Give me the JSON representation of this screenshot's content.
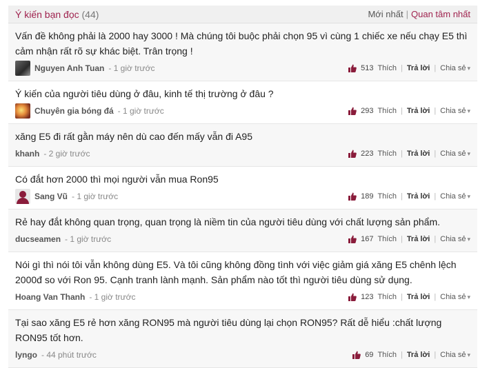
{
  "header": {
    "title": "Ý kiến bạn đọc",
    "count": "(44)",
    "sort_newest": "Mới nhất",
    "separator": "|",
    "sort_popular": "Quan tâm nhất"
  },
  "comments": [
    {
      "text": "Vấn đề không phải là 2000 hay 3000 ! Mà chúng tôi buộc phải chọn 95 vì cùng 1 chiếc xe nếu chạy E5 thì cảm nhận rất rõ sự khác biệt. Trân trọng !",
      "author": "Nguyen Anh Tuan",
      "time": "- 1 giờ trước",
      "likes": "513",
      "like_label": "Thích",
      "reply_label": "Trả lời",
      "share_label": "Chia sẻ"
    },
    {
      "text": "Ý kiến của người tiêu dùng ở đâu, kinh tế thị trường ở đâu ?",
      "author": "Chuyên gia bóng đá",
      "time": "- 1 giờ trước",
      "likes": "293",
      "like_label": "Thích",
      "reply_label": "Trả lời",
      "share_label": "Chia sẻ"
    },
    {
      "text": "xăng E5 đi rất gằn máy nên dù cao đến mấy vẫn đi A95",
      "author": "khanh",
      "time": "- 2 giờ trước",
      "likes": "223",
      "like_label": "Thích",
      "reply_label": "Trả lời",
      "share_label": "Chia sẻ"
    },
    {
      "text": "Có đắt hơn 2000 thì mọi người vẫn mua Ron95",
      "author": "Sang Vũ",
      "time": "- 1 giờ trước",
      "likes": "189",
      "like_label": "Thích",
      "reply_label": "Trả lời",
      "share_label": "Chia sẻ"
    },
    {
      "text": "Rẻ hay đắt không quan trọng, quan trọng là niềm tin của người tiêu dùng với chất lượng sản phẩm.",
      "author": "ducseamen",
      "time": "- 1 giờ trước",
      "likes": "167",
      "like_label": "Thích",
      "reply_label": "Trả lời",
      "share_label": "Chia sẻ"
    },
    {
      "text": "Nói gì thì nói tôi vẫn không dùng E5. Và tôi cũng không đồng tình với việc giảm giá xăng E5 chênh lệch 2000đ so với Ron 95. Cạnh tranh lành mạnh. Sản phẩm nào tốt thì người tiêu dùng sử dụng.",
      "author": "Hoang Van Thanh",
      "time": "- 1 giờ trước",
      "likes": "123",
      "like_label": "Thích",
      "reply_label": "Trả lời",
      "share_label": "Chia sẻ"
    },
    {
      "text": "Tại sao xăng E5 rẻ hơn xăng RON95 mà người tiêu dùng lại chọn RON95? Rất dễ hiểu :chất lượng RON95 tốt hơn.",
      "author": "lyngo",
      "time": "- 44 phút trước",
      "likes": "69",
      "like_label": "Thích",
      "reply_label": "Trả lời",
      "share_label": "Chia sẻ"
    }
  ],
  "colors": {
    "accent": "#9f224e",
    "like_icon": "#8a1c3b",
    "header_bg": "#f0f0f0",
    "alt_row_bg": "#f7f7f7"
  },
  "icons": {
    "like": "thumbs-up-icon",
    "share_dropdown": "chevron-down-icon"
  }
}
